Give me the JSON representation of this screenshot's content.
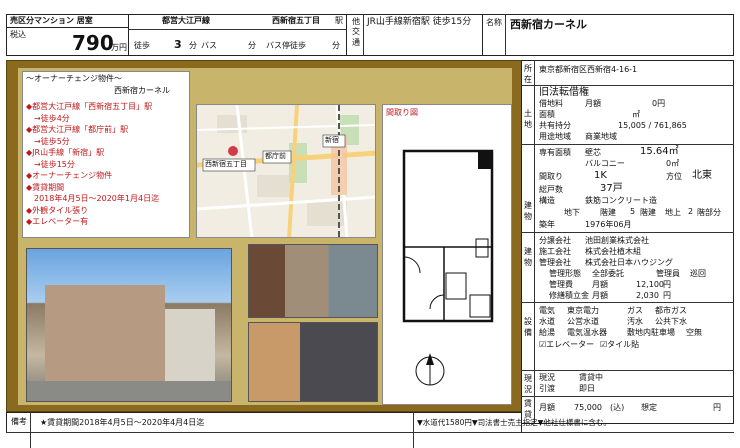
{
  "header": {
    "category": "売区分マンション 居室",
    "tax_label": "税込",
    "price": "790",
    "price_unit": "万円",
    "line_name": "都営大江戸線",
    "station": "西新宿五丁目",
    "station_suffix": "駅",
    "walk_label": "徒歩",
    "walk_min": "3",
    "min_unit": "分",
    "bus_label": "バス",
    "bus_min_unit": "分",
    "bus_stop_label": "バス停徒歩",
    "bus_stop_min_unit": "分",
    "other_label": "他交",
    "other_label2": "通",
    "other_text": "JR山手線新宿駅 徒歩15分",
    "name_label": "名称",
    "name": "西新宿カーネル"
  },
  "left_panel": {
    "owner_change_title": "～オーナーチェンジ物件～",
    "building_name": "西新宿カーネル",
    "features": [
      "◆都営大江戸線「西新宿五丁目」駅",
      "　→徒歩4分",
      "◆都営大江戸線「都庁前」駅",
      "　→徒歩5分",
      "◆JR山手線「新宿」駅",
      "　→徒歩15分",
      "◆オーナーチェンジ物件",
      "◆賃貸期間",
      "　2018年4月5日～2020年1月4日迄",
      "◆外観タイル張り",
      "◆エレベーター有"
    ],
    "floor_plan_label": "間取り図",
    "map_labels": [
      "西新宿五丁目",
      "都庁前",
      "新宿"
    ]
  },
  "right_table": {
    "location_label": "所在",
    "location": "東京都新宿区西新宿4-16-1",
    "land_label": "土地",
    "land_rights": "旧法転借権",
    "land_rent_label": "借地料",
    "land_rent_period": "月額",
    "land_rent_value": "0円",
    "area_label": "面積",
    "area_unit": "㎡",
    "share_label": "共有持分",
    "share_value": "15,005 / 761,865",
    "zoning_label": "用途地域",
    "zoning": "商業地域",
    "building_label": "建物",
    "exclusive_label": "専有面積",
    "wall_label": "壁芯",
    "exclusive_area": "15.64㎡",
    "balcony_label": "バルコニー",
    "balcony_area": "0㎡",
    "layout_label": "間取り",
    "layout": "1K",
    "direction_label": "方位",
    "direction": "北東",
    "units_label": "総戸数",
    "units": "37戸",
    "structure_label": "構造",
    "structure": "鉄筋コンクリート造",
    "floors_ground": "地下",
    "floors_building": "階建",
    "floors_above": "地上",
    "floors_count": "5",
    "floors_unit": "階建",
    "floor_label": "地上",
    "floor_value": "2",
    "floor_unit": "階部分",
    "built_label": "築年",
    "built": "1976年06月",
    "sale_label": "分譲会社",
    "sale_company": "池田創業株式会社",
    "builder_label": "施工会社",
    "builder": "株式会社植木組",
    "mgmt_label": "管理会社",
    "mgmt_company": "株式会社日本ハウジング",
    "mgmt_form_label": "管理形態",
    "mgmt_form": "全部委託",
    "manager_label": "管理員",
    "manager": "巡回",
    "mgmt_fee_label": "管理費",
    "mgmt_fee_period": "月額",
    "mgmt_fee": "12,100",
    "mgmt_fee_unit": "円",
    "repair_label": "修繕積立金",
    "repair_period": "月額",
    "repair_fee": "2,030",
    "repair_unit": "円",
    "util_label": "設備",
    "electric_label": "電気",
    "electric": "東京電力",
    "gas_label": "ガス",
    "gas": "都市ガス",
    "water_label": "水道",
    "water": "公営水道",
    "sewage_label": "汚水",
    "sewage": "公共下水",
    "hotwater_label": "給湯",
    "hotwater": "電気温水器",
    "parking_label": "敷地内駐車場",
    "parking": "空無",
    "elevator_check": "☑エレベーター",
    "tile_check": "☑タイル貼",
    "current_label": "現況",
    "current": "賃貸中",
    "handover_label": "引渡",
    "handover": "即日",
    "rent_side_label": "賃貸",
    "rent_label": "月額",
    "rent": "75,000",
    "rent_note": "(込)",
    "rent_period": "想定",
    "rent_unit": "円"
  },
  "bottom": {
    "remark_label": "備考",
    "remark_left": "★賃貸期間2018年4月5日～2020年4月4日迄",
    "remark_right": "▼水道代1580円▼司法書士売主指定▼他社仕様書に含む。"
  },
  "colors": {
    "gold_frame": "#8a6a1e",
    "panel_bg": "#c8b46a",
    "red": "#c0181b"
  }
}
